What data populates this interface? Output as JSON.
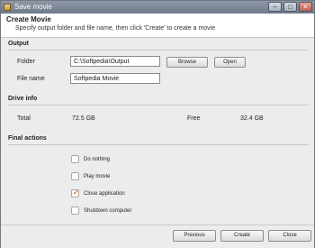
{
  "window": {
    "title": "Save movie"
  },
  "header": {
    "title": "Create Movie",
    "subtitle": "Specify output folder and file name, then click 'Create' to create a movie"
  },
  "output": {
    "section_title": "Output",
    "folder_label": "Folder",
    "folder_value": "C:\\Softpedia\\Output",
    "browse_label": "Browse",
    "open_label": "Open",
    "filename_label": "File name",
    "filename_value": "Softpedia Movie"
  },
  "drive": {
    "section_title": "Drive info",
    "total_label": "Total",
    "total_value": "72.5 GB",
    "free_label": "Free",
    "free_value": "32.4 GB"
  },
  "final_actions": {
    "section_title": "Final actions",
    "options": [
      {
        "label": "Do nothing",
        "checked": false
      },
      {
        "label": "Play movie",
        "checked": false
      },
      {
        "label": "Close application",
        "checked": true
      },
      {
        "label": "Shutdown computer",
        "checked": false
      }
    ]
  },
  "footer": {
    "previous_label": "Previous",
    "create_label": "Create",
    "close_label": "Close"
  }
}
